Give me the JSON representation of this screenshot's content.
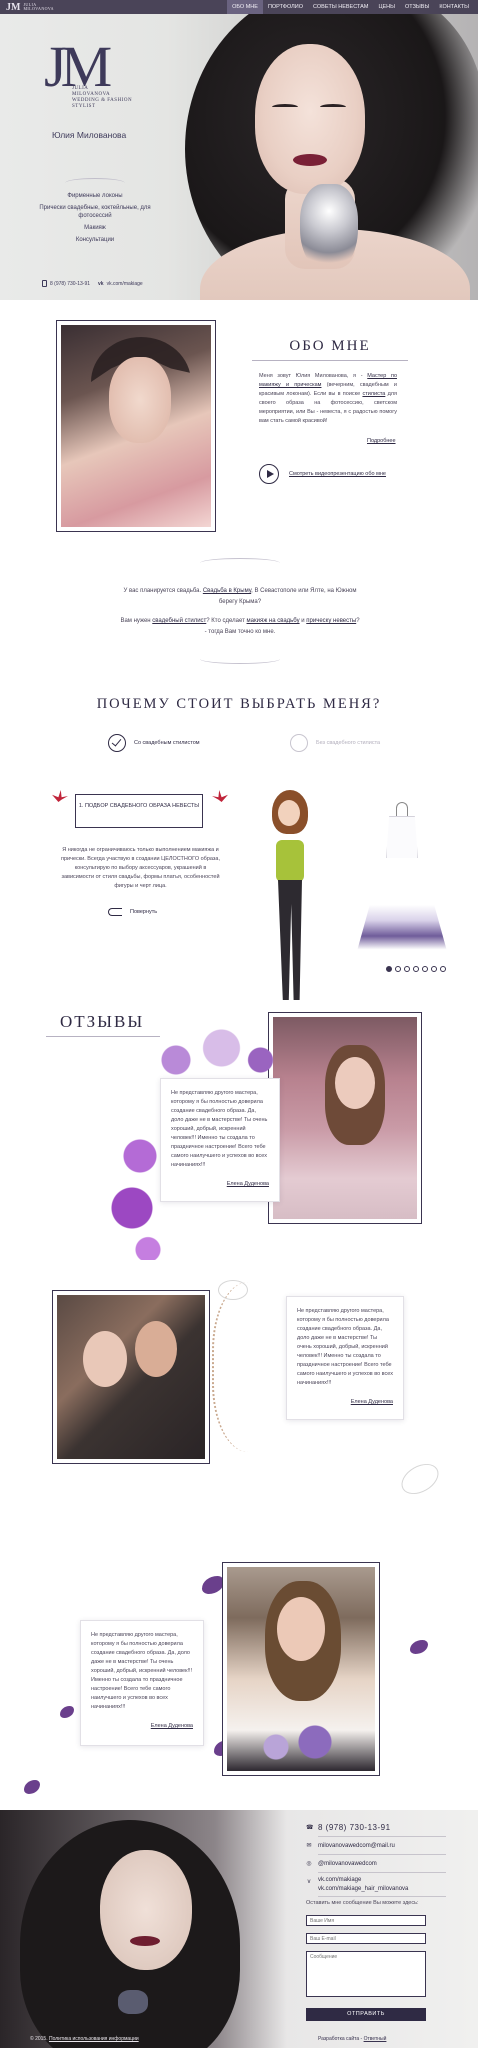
{
  "brand": {
    "monogram": "JM",
    "name_line1": "JULIA",
    "name_line2": "MILOVANOVA"
  },
  "nav": {
    "items": [
      "ОБО МНЕ",
      "ПОРТФОЛИО",
      "СОВЕТЫ НЕВЕСТАМ",
      "ЦЕНЫ",
      "ОТЗЫВЫ",
      "КОНТАКТЫ"
    ],
    "active": "ОБО МНЕ"
  },
  "hero": {
    "logo_monogram": "JM",
    "logo_text": [
      "JULIA",
      "MILOVANOVA",
      "WEDDING & FASHION",
      "STYLIST"
    ],
    "name": "Юлия Милованова",
    "services": [
      "Фирменные локоны",
      "Прически свадебные, коктейльные, для фотосессий",
      "Макияж",
      "Консультации"
    ],
    "phone": "8 (978) 730-13-91",
    "vk": "vk.com/makiage"
  },
  "about": {
    "title": "ОБО МНЕ",
    "text_parts": [
      "Меня зовут Юлия Милованова, я - ",
      "Мастер по макияжу и прическам",
      " (вечерним, свадебным и красивым локонам). Если вы в поиске ",
      "стилиста",
      " для своего образа на фотосессию, светском мероприятии, или Вы - невеста, я с радостью помогу вам стать самой красивой!"
    ],
    "more_link": "Подробнее",
    "video_link": "Смотреть видеопрезентацию обо мне"
  },
  "question": {
    "line1_parts": [
      "У вас планируется свадьба. ",
      "Свадьба в Крыму",
      ", В Севастополе или Ялте, на Южном берегу Крыма?"
    ],
    "line2_parts": [
      "Вам нужен ",
      "свадебный стилист",
      "? Кто сделает ",
      "макияж на свадьбу",
      " и ",
      "прическу невесты",
      "? - тогда Вам точно ко мне."
    ]
  },
  "why": {
    "title": "ПОЧЕМУ СТОИТ ВЫБРАТЬ МЕНЯ?",
    "tab_with": "Со свадебным стилистом",
    "tab_without": "Без свадебного стилиста",
    "box_text": "1. ПОДБОР СВАДЕБНОГО ОБРАЗА НЕВЕСТЫ",
    "description": "Я никогда не ограничиваюсь только выполнением макияжа и прически. Всегда участвую в создании ЦЕЛОСТНОГО образа, консультирую по выбору аксессуаров, украшений в зависимости от стиля свадьбы, формы платья, особенностей фигуры и черт лица.",
    "flip_label": "Повернуть",
    "slides_total": 7,
    "slide_active": 1
  },
  "reviews": {
    "title": "ОТЗЫВЫ",
    "items": [
      {
        "text": "Не представляю другого мастера, которому я бы полностью доверила создание свадебного образа. Да, доло даже не в мастерстве! Ты очень хороший, добрый, искренний человек!!! Именно ты создала то праздничное настроение! Всего тебе самого наилучшего и успехов во всех начинаниях!!!",
        "author": "Елена Дуденова"
      },
      {
        "text": "Не представляю другого мастера, которому я бы полностью доверила создание свадебного образа. Да, доло даже не в мастерстве! Ты очень хороший, добрый, искренний человек!!! Именно ты создала то праздничное настроение! Всего тебе самого наилучшего и успехов во всех начинаниях!!!",
        "author": "Елена Дуденова"
      },
      {
        "text": "Не представляю другого мастера, которому я бы полностью доверила создание свадебного образа. Да, доло даже не в мастерстве! Ты очень хороший, добрый, искренний человек!!! Именно ты создала то праздничное настроение! Всего тебе самого наилучшего и успехов во всех начинаниях!!!",
        "author": "Елена Дуденова"
      }
    ]
  },
  "footer": {
    "phone": "8 (978) 730-13-91",
    "email1": "milovanovawedcom@mail.ru",
    "email2": "@milovanovawedcom",
    "vk1": "vk.com/makiage",
    "vk2": "vk.com/makiage_hair_milovanova",
    "form_title": "Оставить мне сообщение Вы можете здесь:",
    "name_placeholder": "Ваше Имя",
    "email_placeholder": "Ваш E-mail",
    "message_placeholder": "Сообщение",
    "send_label": "ОТПРАВИТЬ",
    "copyright_text": "© 2015. ",
    "copyright_link": "Политика использования информации",
    "dev_text": "Разработка сайта - ",
    "dev_link": "Ответный"
  }
}
